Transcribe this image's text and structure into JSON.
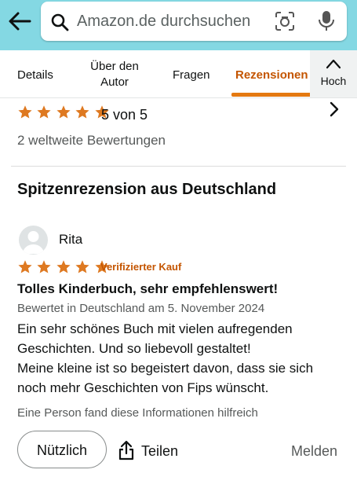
{
  "search": {
    "placeholder": "Amazon.de durchsuchen"
  },
  "tabs": [
    {
      "label": "Details"
    },
    {
      "label_line1": "Über den",
      "label_line2": "Autor"
    },
    {
      "label": "Fragen"
    },
    {
      "label": "Rezensionen"
    }
  ],
  "collapse": {
    "label": "Hoch"
  },
  "summary": {
    "rating_text": "5 von 5",
    "rating_value": 5,
    "global_ratings": "2 weltweite Bewertungen"
  },
  "section": {
    "title": "Spitzenrezension aus Deutschland"
  },
  "review": {
    "reviewer": "Rita",
    "rating_value": 5,
    "verified": "Verifizierter Kauf",
    "title": "Tolles Kinderbuch, sehr empfehlenswert!",
    "date": "Bewertet in Deutschland am 5. November 2024",
    "body_lines": [
      "Ein sehr schönes Buch mit vielen aufregenden",
      "Geschichten. Und so liebevoll gestaltet!",
      "Meine kleine ist so begeistert davon, dass sie sich",
      "noch mehr Geschichten von Fips wünscht."
    ],
    "helpful_note": "Eine Person fand diese Informationen hilfreich"
  },
  "actions": {
    "helpful": "Nützlich",
    "share": "Teilen",
    "report": "Melden"
  },
  "colors": {
    "header_bg": "#84d8e3",
    "star": "#de7921",
    "accent": "#c45500",
    "tab_underline": "#e47911"
  }
}
